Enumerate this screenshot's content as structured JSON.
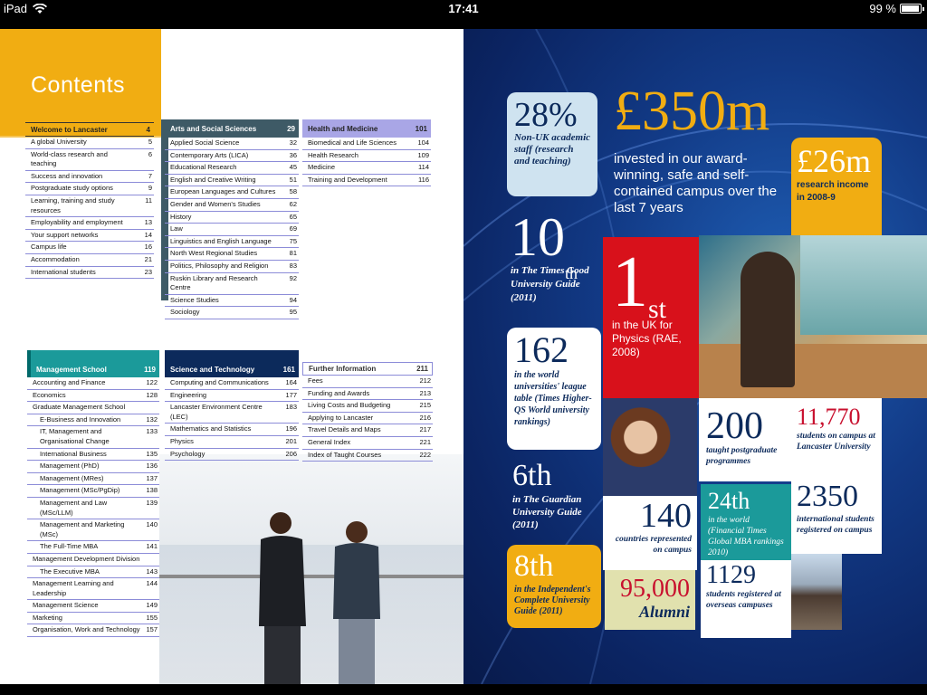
{
  "status": {
    "device": "iPad",
    "time": "17:41",
    "battery": "99 %"
  },
  "left": {
    "title": "Contents",
    "welcome": {
      "header": "Welcome to Lancaster",
      "page": "4",
      "items": [
        {
          "t": "A global University",
          "p": "5"
        },
        {
          "t": "World-class research and teaching",
          "p": "6"
        },
        {
          "t": "Success and innovation",
          "p": "7"
        },
        {
          "t": "Postgraduate study options",
          "p": "9"
        },
        {
          "t": "Learning, training and study resources",
          "p": "11"
        },
        {
          "t": "Employability and employment",
          "p": "13"
        },
        {
          "t": "Your support networks",
          "p": "14"
        },
        {
          "t": "Campus life",
          "p": "16"
        },
        {
          "t": "Accommodation",
          "p": "21"
        },
        {
          "t": "International students",
          "p": "23"
        }
      ]
    },
    "arts": {
      "header": "Arts and Social Sciences",
      "page": "29",
      "items": [
        {
          "t": "Applied Social Science",
          "p": "32"
        },
        {
          "t": "Contemporary Arts (LICA)",
          "p": "36"
        },
        {
          "t": "Educational Research",
          "p": "45"
        },
        {
          "t": "English and Creative Writing",
          "p": "51"
        },
        {
          "t": "European Languages and Cultures",
          "p": "58"
        },
        {
          "t": "Gender and Women's Studies",
          "p": "62"
        },
        {
          "t": "History",
          "p": "65"
        },
        {
          "t": "Law",
          "p": "69"
        },
        {
          "t": "Linguistics and English Language",
          "p": "75"
        },
        {
          "t": "North West Regional Studies",
          "p": "81"
        },
        {
          "t": "Politics, Philosophy and Religion",
          "p": "83"
        },
        {
          "t": "Ruskin Library and Research Centre",
          "p": "92"
        },
        {
          "t": "Science Studies",
          "p": "94"
        },
        {
          "t": "Sociology",
          "p": "95"
        }
      ]
    },
    "health": {
      "header": "Health and Medicine",
      "page": "101",
      "items": [
        {
          "t": "Biomedical and Life Sciences",
          "p": "104"
        },
        {
          "t": "Health Research",
          "p": "109"
        },
        {
          "t": "Medicine",
          "p": "114"
        },
        {
          "t": "Training and Development",
          "p": "116"
        }
      ]
    },
    "mgmt": {
      "header": "Management School",
      "page": "119",
      "items": [
        {
          "t": "Accounting and Finance",
          "p": "122",
          "i": 0
        },
        {
          "t": "Economics",
          "p": "128",
          "i": 0
        },
        {
          "t": "Graduate Management School",
          "p": "",
          "i": 0
        },
        {
          "t": "E-Business and Innovation",
          "p": "132",
          "i": 1
        },
        {
          "t": "IT, Management and Organisational Change",
          "p": "133",
          "i": 1
        },
        {
          "t": "International Business",
          "p": "135",
          "i": 1
        },
        {
          "t": "Management (PhD)",
          "p": "136",
          "i": 1
        },
        {
          "t": "Management (MRes)",
          "p": "137",
          "i": 1
        },
        {
          "t": "Management (MSc/PgDip)",
          "p": "138",
          "i": 1
        },
        {
          "t": "Management and Law (MSc/LLM)",
          "p": "139",
          "i": 1
        },
        {
          "t": "Management and Marketing (MSc)",
          "p": "140",
          "i": 1
        },
        {
          "t": "The Full-Time MBA",
          "p": "141",
          "i": 1
        },
        {
          "t": "Management Development Division",
          "p": "",
          "i": 0
        },
        {
          "t": "The Executive MBA",
          "p": "143",
          "i": 1
        },
        {
          "t": "Management Learning and Leadership",
          "p": "144",
          "i": 0
        },
        {
          "t": "Management Science",
          "p": "149",
          "i": 0
        },
        {
          "t": "Marketing",
          "p": "155",
          "i": 0
        },
        {
          "t": "Organisation, Work and Technology",
          "p": "157",
          "i": 0
        }
      ]
    },
    "sci": {
      "header": "Science and Technology",
      "page": "161",
      "items": [
        {
          "t": "Computing and Communications",
          "p": "164"
        },
        {
          "t": "Engineering",
          "p": "177"
        },
        {
          "t": "Lancaster Environment Centre (LEC)",
          "p": "183"
        },
        {
          "t": "Mathematics and Statistics",
          "p": "196"
        },
        {
          "t": "Physics",
          "p": "201"
        },
        {
          "t": "Psychology",
          "p": "206"
        }
      ]
    },
    "further": {
      "header": "Further Information",
      "page": "211",
      "items": [
        {
          "t": "Fees",
          "p": "212"
        },
        {
          "t": "Funding and Awards",
          "p": "213"
        },
        {
          "t": "Living Costs and Budgeting",
          "p": "215"
        },
        {
          "t": "Applying to Lancaster",
          "p": "216"
        },
        {
          "t": "Travel Details and Maps",
          "p": "217"
        },
        {
          "t": "General Index",
          "p": "221"
        },
        {
          "t": "Index of Taught Courses",
          "p": "222"
        }
      ]
    }
  },
  "right": {
    "s28": {
      "big": "28%",
      "sm": "Non-UK academic staff (research and teaching)"
    },
    "s350": {
      "big": "£350m",
      "sm": "invested in our award-winning, safe and self-contained campus over the last 7 years"
    },
    "s26": {
      "big": "£26m",
      "sm": "research income in 2008-9"
    },
    "s10": {
      "big": "10",
      "sup": "th",
      "sm": "in The Times Good University Guide (2011)"
    },
    "s1st": {
      "big": "1",
      "sup": "st",
      "sm": "in the UK for Physics (RAE, 2008)"
    },
    "s162": {
      "big": "162",
      "sm": "in the world universities' league table (Times Higher-QS World university rankings)"
    },
    "s6": {
      "big": "6th",
      "sm": "in The Guardian University Guide (2011)"
    },
    "s8": {
      "big": "8th",
      "sm": "in the Independent's Complete University Guide (2011)"
    },
    "s200": {
      "big": "200",
      "sm": "taught postgraduate programmes"
    },
    "s11770": {
      "big": "11,770",
      "sm": "students on campus at Lancaster University"
    },
    "s24": {
      "big": "24th",
      "sm": "in the world (Financial Times Global MBA rankings 2010)"
    },
    "s2350": {
      "big": "2350",
      "sm": "international students registered on campus"
    },
    "s140": {
      "big": "140",
      "sm": "countries represented on campus"
    },
    "s95": {
      "big": "95,000",
      "sm": "Alumni"
    },
    "s1129": {
      "big": "1129",
      "sm": "students registered at overseas campuses"
    }
  }
}
